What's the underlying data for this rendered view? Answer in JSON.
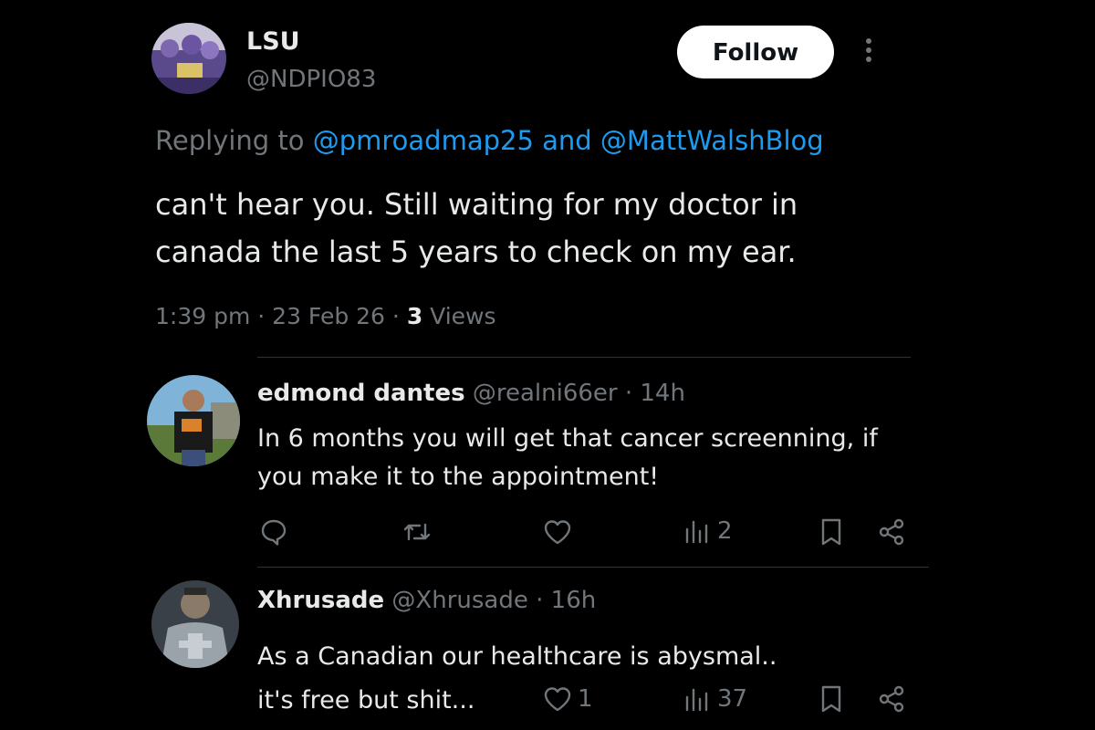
{
  "tweet": {
    "author_name": "LSU",
    "author_handle": "@NDPIO83",
    "follow_label": "Follow",
    "replying_prefix": "Replying to",
    "reply_target_1": "@pmroadmap25",
    "reply_conj": "and",
    "reply_target_2": "@MattWalshBlog",
    "text_line_1": "can't hear you. Still waiting for my doctor in",
    "text_line_2": "canada the last 5 years to check on my ear.",
    "time": "1:39 pm",
    "date": "23 Feb 26",
    "views_count": "3",
    "views_label": "Views",
    "sep": "·"
  },
  "replies": [
    {
      "name": "edmond dantes",
      "handle": "@realni66er",
      "age": "14h",
      "text_line_1": "In 6 months you will get that cancer screenning, if",
      "text_line_2": "you make it to the appointment!",
      "views": "2"
    },
    {
      "name": "Xhrusade",
      "handle": "@Xhrusade",
      "age": "16h",
      "text_line_1": "As a Canadian our healthcare is abysmal..",
      "text_line_2": "it's free but shit...",
      "likes": "1",
      "views": "37"
    }
  ],
  "icons": {
    "reply": "comment-icon",
    "retweet": "retweet-icon",
    "like": "heart-icon",
    "views": "bar-chart-icon",
    "bookmark": "bookmark-icon",
    "share": "share-icon",
    "more": "more-vertical-icon"
  },
  "colors": {
    "background": "#000000",
    "text": "#e7e9ea",
    "muted": "#71767b",
    "link": "#1d9bf0",
    "button_bg": "#ffffff"
  }
}
